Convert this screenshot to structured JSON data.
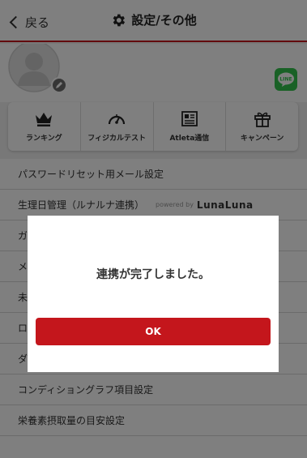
{
  "header": {
    "back_label": "戻る",
    "title": "設定/その他"
  },
  "profile": {
    "line_label": "LINE"
  },
  "menu": [
    {
      "label": "ランキング",
      "icon": "crown-icon"
    },
    {
      "label": "フィジカルテスト",
      "icon": "gauge-icon"
    },
    {
      "label": "Atleta通信",
      "icon": "newspaper-icon"
    },
    {
      "label": "キャンペーン",
      "icon": "gift-icon"
    }
  ],
  "list": [
    {
      "label": "パスワードリセット用メール設定"
    },
    {
      "label": "生理日管理（ルナルナ連携）",
      "powered_by": "powered by",
      "brand": "LunaLuna"
    },
    {
      "label": "ガ"
    },
    {
      "label": "メ"
    },
    {
      "label": "未"
    },
    {
      "label": "ロ"
    },
    {
      "label": "ダ"
    },
    {
      "label": "コンディショングラフ項目設定"
    },
    {
      "label": "栄養素摂取量の目安設定"
    },
    {
      "label": ""
    }
  ],
  "modal": {
    "message": "連携が完了しました。",
    "ok_label": "OK"
  },
  "colors": {
    "accent": "#c4161c",
    "line_green": "#33c24c"
  }
}
